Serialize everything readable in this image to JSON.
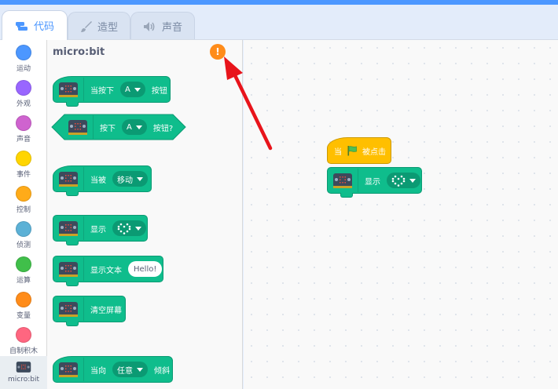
{
  "tabs": [
    {
      "label": "代码",
      "icon": "code-icon",
      "active": true
    },
    {
      "label": "造型",
      "icon": "brush-icon",
      "active": false
    },
    {
      "label": "声音",
      "icon": "speaker-icon",
      "active": false
    }
  ],
  "categories": [
    {
      "label": "运动",
      "color": "#4c97ff"
    },
    {
      "label": "外观",
      "color": "#9966ff"
    },
    {
      "label": "声音",
      "color": "#cf63cf"
    },
    {
      "label": "事件",
      "color": "#ffd500"
    },
    {
      "label": "控制",
      "color": "#ffab19"
    },
    {
      "label": "侦测",
      "color": "#5cb1d6"
    },
    {
      "label": "运算",
      "color": "#40bf4a"
    },
    {
      "label": "变量",
      "color": "#ff8c1a"
    },
    {
      "label": "自制积木",
      "color": "#ff6680"
    },
    {
      "label": "micro:bit",
      "color": "#0fbd8c"
    }
  ],
  "palette": {
    "title": "micro:bit",
    "warning_symbol": "!",
    "blocks": {
      "when_pressed": {
        "prefix": "当按下",
        "button": "A",
        "suffix": "按钮"
      },
      "is_pressed": {
        "prefix": "按下",
        "button": "A",
        "suffix": "按钮?"
      },
      "when_gesture": {
        "prefix": "当被",
        "gesture": "移动"
      },
      "display": {
        "label": "显示"
      },
      "display_text": {
        "label": "显示文本",
        "text": "Hello!"
      },
      "clear": {
        "label": "清空屏幕"
      },
      "when_tilted": {
        "prefix": "当向",
        "direction": "任意",
        "suffix": "倾斜"
      }
    }
  },
  "script": {
    "hat": {
      "prefix": "当",
      "suffix": "被点击"
    },
    "display": {
      "label": "显示"
    }
  },
  "colors": {
    "extension_green": "#0fbd8c",
    "event_yellow": "#ffbf00",
    "annotation_red": "#e8141b"
  }
}
